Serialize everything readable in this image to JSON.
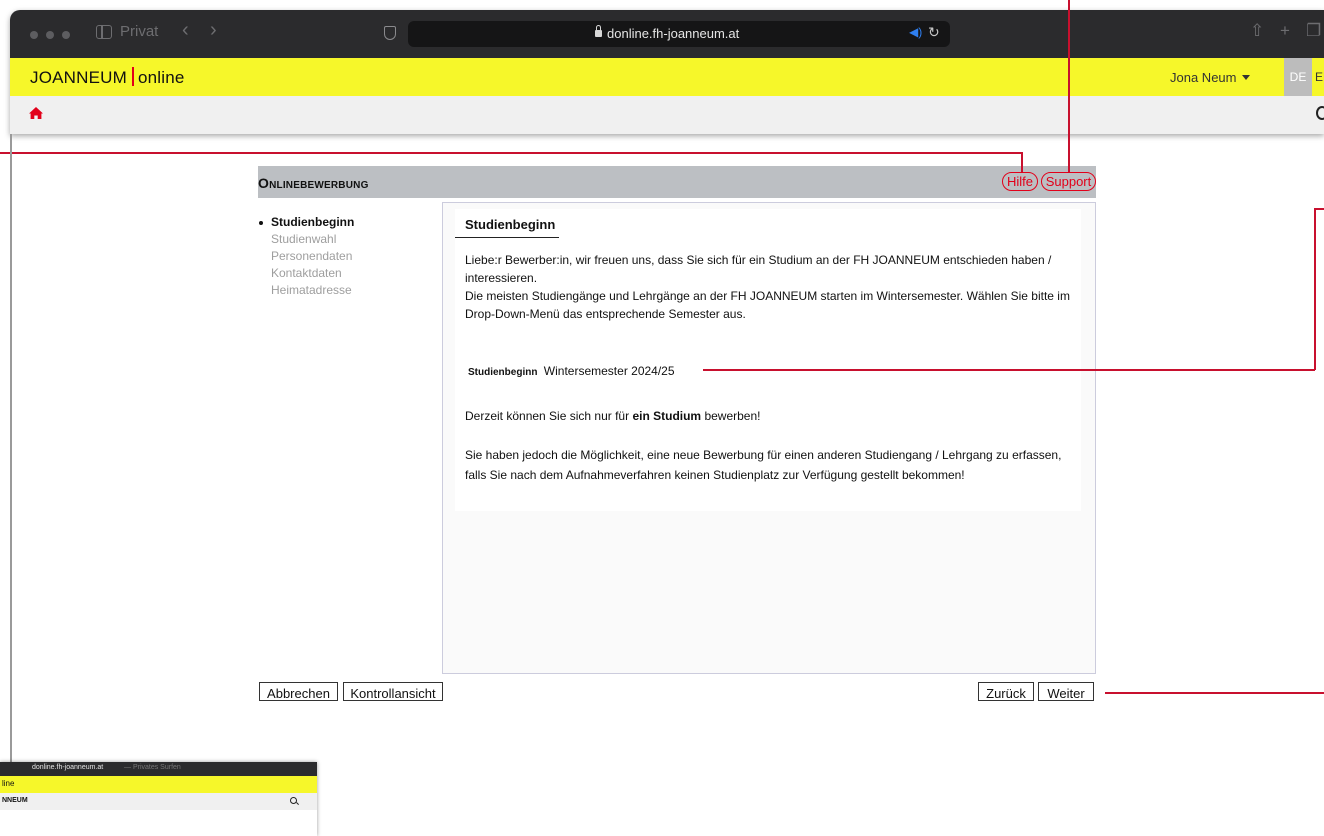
{
  "browser": {
    "tab_label": "Privat",
    "url": "donline.fh-joanneum.at"
  },
  "header": {
    "logo_left": "JOANNEUM",
    "logo_right": "online",
    "user_name": "Jona Neum",
    "lang_de": "DE",
    "lang_en": "EN"
  },
  "page": {
    "title": "Onlinebewerbung",
    "help_label": "Hilfe",
    "support_label": "Support"
  },
  "steps": [
    {
      "label": "Studienbeginn",
      "active": true
    },
    {
      "label": "Studienwahl",
      "active": false
    },
    {
      "label": "Personendaten",
      "active": false
    },
    {
      "label": "Kontaktdaten",
      "active": false
    },
    {
      "label": "Heimatadresse",
      "active": false
    }
  ],
  "section": {
    "heading": "Studienbeginn",
    "intro_line1": "Liebe:r Bewerber:in, wir freuen uns, dass Sie sich für ein Studium an der FH JOANNEUM entschieden haben / interessieren.",
    "intro_line2": "Die meisten Studiengänge und Lehrgänge an der FH JOANNEUM starten im Wintersemester. Wählen Sie bitte im Drop-Down-Menü das entsprechende Semester aus.",
    "start_label": "Studienbeginn",
    "start_value": "Wintersemester 2024/25",
    "note_prefix": "Derzeit können Sie sich nur für",
    "note_bold": "ein Studium",
    "note_suffix": "bewerben!",
    "note2": "Sie haben jedoch die Möglichkeit, eine neue Bewerbung für einen anderen Studiengang / Lehrgang zu erfassen, falls Sie nach dem Aufnahmeverfahren keinen Studienplatz zur Verfügung gestellt bekommen!"
  },
  "buttons": {
    "cancel": "Abbrechen",
    "review": "Kontrollansicht",
    "back": "Zurück",
    "next": "Weiter"
  },
  "thumbnail": {
    "url": "donline.fh-joanneum.at",
    "mode": "— Privates Surfen",
    "logo_fragment": "line",
    "brand_fragment": "NNEUM"
  },
  "colors": {
    "brand_yellow": "#f6f72a",
    "accent_red": "#e2001a",
    "annotation_red": "#c8102e"
  }
}
